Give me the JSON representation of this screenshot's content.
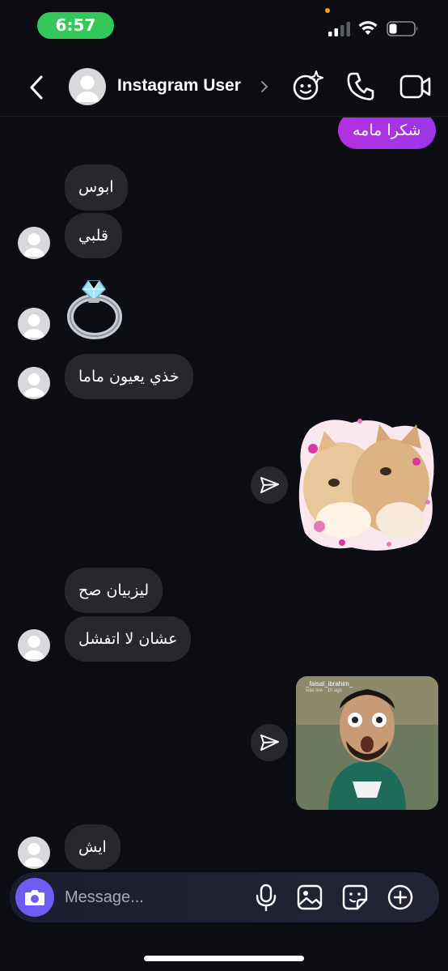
{
  "status_bar": {
    "time": "6:57",
    "battery_percent": 25
  },
  "header": {
    "contact_name": "Instagram User"
  },
  "messages": {
    "out_1": "شكرا مامه",
    "in_1": "ابوس",
    "in_2": "قلبي",
    "in_3_emoji": "ring",
    "in_4": "خذي يعيون ماما",
    "out_sticker": "kittens-kissing-sticker",
    "in_5": "ليزبيان صح",
    "in_6": "عشان لا اتفشل",
    "reel": {
      "username": "_faisal_ibrahim_",
      "subtitle": "was live · 1h ago"
    },
    "in_7": "ايش"
  },
  "composer": {
    "placeholder": "Message..."
  },
  "colors": {
    "accent": "#a52ed8",
    "camera": "#6d5df2",
    "bubble_in": "#26282e",
    "time_pill": "#34c759"
  }
}
